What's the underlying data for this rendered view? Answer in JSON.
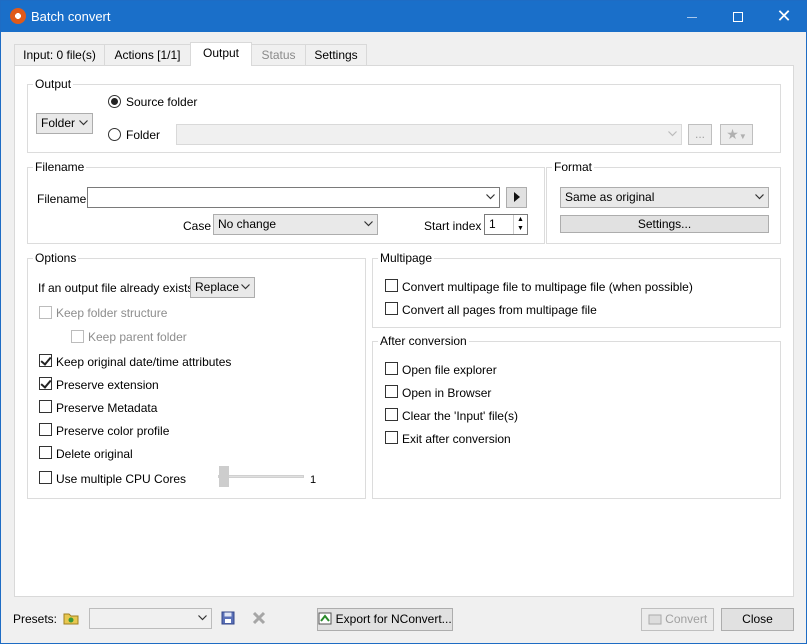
{
  "window": {
    "title": "Batch convert"
  },
  "tabs": [
    {
      "label": "Input: 0 file(s)"
    },
    {
      "label": "Actions [1/1]"
    },
    {
      "label": "Output"
    },
    {
      "label": "Status"
    },
    {
      "label": "Settings"
    }
  ],
  "output": {
    "group_label": "Output",
    "type_value": "Folder",
    "source_folder_label": "Source folder",
    "folder_label": "Folder",
    "folder_value": "",
    "browse_label": "..."
  },
  "filename": {
    "group_label": "Filename",
    "field_label": "Filename",
    "value": "",
    "case_label": "Case",
    "case_value": "No change",
    "start_index_label": "Start index",
    "start_index_value": "1"
  },
  "format": {
    "group_label": "Format",
    "value": "Same as original",
    "settings_label": "Settings..."
  },
  "options": {
    "group_label": "Options",
    "exists_label": "If an output file already exists",
    "exists_value": "Replace",
    "keep_folder_structure": "Keep folder structure",
    "keep_parent_folder": "Keep parent folder",
    "keep_datetime": "Keep original date/time attributes",
    "preserve_extension": "Preserve extension",
    "preserve_metadata": "Preserve Metadata",
    "preserve_color_profile": "Preserve color profile",
    "delete_original": "Delete original",
    "multiple_cores": "Use multiple CPU Cores",
    "cores_value": "1"
  },
  "multipage": {
    "group_label": "Multipage",
    "convert_multipage": "Convert multipage file to multipage file (when possible)",
    "convert_all_pages": "Convert all pages from multipage file"
  },
  "after": {
    "group_label": "After conversion",
    "open_explorer": "Open file explorer",
    "open_browser": "Open in Browser",
    "clear_input": "Clear the 'Input' file(s)",
    "exit_after": "Exit after conversion"
  },
  "footer": {
    "presets_label": "Presets:",
    "presets_value": "",
    "export_label": "Export for NConvert...",
    "convert_label": "Convert",
    "close_label": "Close"
  }
}
